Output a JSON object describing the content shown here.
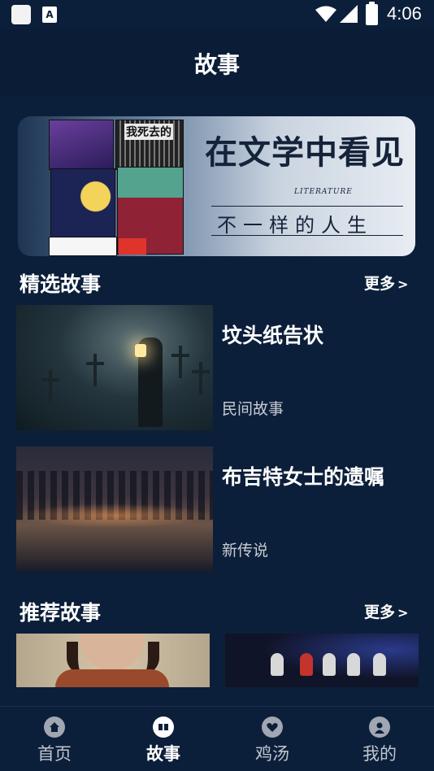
{
  "status": {
    "time": "4:06"
  },
  "header": {
    "title": "故事"
  },
  "banner": {
    "title": "在文学中看见",
    "subtitle": "LITERATURE",
    "tagline": "不一样的人生",
    "book_label": "我死去的"
  },
  "featured": {
    "title": "精选故事",
    "more": "更多",
    "items": [
      {
        "title": "坟头纸告状",
        "category": "民间故事"
      },
      {
        "title": "布吉特女士的遗嘱",
        "category": "新传说"
      }
    ]
  },
  "recommended": {
    "title": "推荐故事",
    "more": "更多"
  },
  "tabs": [
    {
      "label": "首页",
      "icon": "home-icon",
      "active": false
    },
    {
      "label": "故事",
      "icon": "book-icon",
      "active": true
    },
    {
      "label": "鸡汤",
      "icon": "heart-icon",
      "active": false
    },
    {
      "label": "我的",
      "icon": "user-icon",
      "active": false
    }
  ],
  "colors": {
    "background": "#0c1f3a",
    "header": "#0b1d36",
    "text": "#ffffff",
    "muted": "#c8ccd3"
  }
}
